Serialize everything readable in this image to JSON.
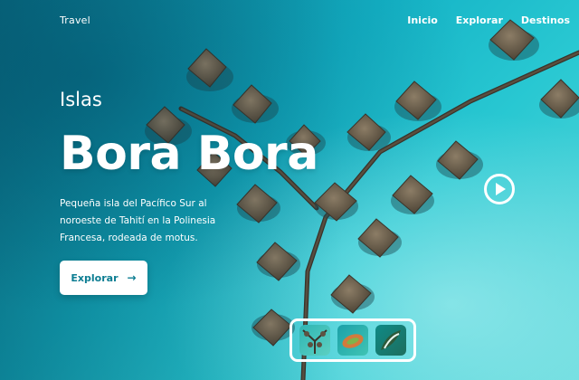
{
  "header": {
    "brand": "Travel",
    "nav": [
      {
        "label": "Inicio"
      },
      {
        "label": "Explorar"
      },
      {
        "label": "Destinos"
      }
    ]
  },
  "hero": {
    "eyebrow": "Islas",
    "title": "Bora Bora",
    "description": "Pequeña isla del Pacífico Sur al noroeste de Tahití en la Polinesia Francesa, rodeada de motus.",
    "cta_label": "Explorar",
    "cta_icon": "arrow-right-icon",
    "play_icon": "play-circle-icon"
  },
  "thumbnails": [
    {
      "name": "thumbnail-overwater-bungalows"
    },
    {
      "name": "thumbnail-coral-reef"
    },
    {
      "name": "thumbnail-lagoon-island"
    }
  ],
  "colors": {
    "accent": "#0c7d92",
    "sea": "#14b3c6",
    "white": "#ffffff"
  }
}
